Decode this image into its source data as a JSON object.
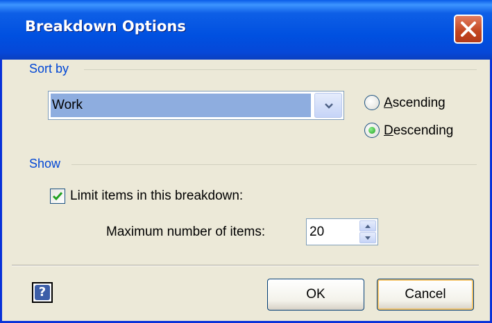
{
  "window": {
    "title": "Breakdown Options"
  },
  "sort_by": {
    "group_label": "Sort by",
    "selected_field": "Work",
    "ascending": {
      "label_accel": "A",
      "label_rest": "scending",
      "checked": false
    },
    "descending": {
      "label_accel": "D",
      "label_rest": "escending",
      "checked": true
    }
  },
  "show": {
    "group_label": "Show",
    "limit_label": "Limit items in this breakdown:",
    "limit_checked": true,
    "max_label": "Maximum number of items:",
    "max_value": "20"
  },
  "buttons": {
    "help": "?",
    "ok": "OK",
    "cancel": "Cancel"
  },
  "colors": {
    "title_bar": "#0054e3",
    "group_label": "#0046d5",
    "radio_selected": "#21a121",
    "check": "#21a121",
    "close": "#c2451f"
  }
}
